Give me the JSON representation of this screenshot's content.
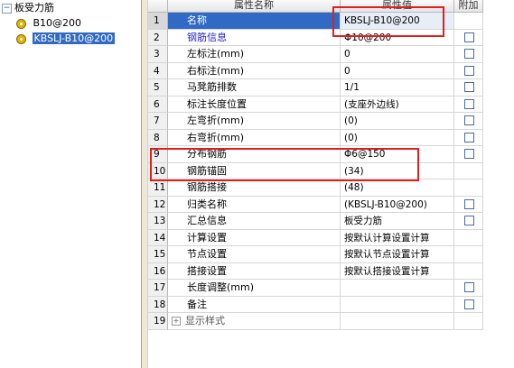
{
  "tree": {
    "root_label": "板受力筋",
    "children": [
      "B10@200",
      "KBSLJ-B10@200"
    ]
  },
  "headers": {
    "name": "属性名称",
    "value": "属性值",
    "extra": "附加"
  },
  "rows": [
    {
      "num": "1",
      "name": "名称",
      "value": "KBSLJ-B10@200",
      "checkbox": false
    },
    {
      "num": "2",
      "name": "钢筋信息",
      "value": "Φ10@200",
      "checkbox": true,
      "blue": true
    },
    {
      "num": "3",
      "name": "左标注(mm)",
      "value": "0",
      "checkbox": true
    },
    {
      "num": "4",
      "name": "右标注(mm)",
      "value": "0",
      "checkbox": true
    },
    {
      "num": "5",
      "name": "马凳筋排数",
      "value": "1/1",
      "checkbox": true
    },
    {
      "num": "6",
      "name": "标注长度位置",
      "value": "(支座外边线)",
      "checkbox": true
    },
    {
      "num": "7",
      "name": "左弯折(mm)",
      "value": "(0)",
      "checkbox": true
    },
    {
      "num": "8",
      "name": "右弯折(mm)",
      "value": "(0)",
      "checkbox": true
    },
    {
      "num": "9",
      "name": "分布钢筋",
      "value": "Φ6@150",
      "checkbox": true
    },
    {
      "num": "10",
      "name": "钢筋锚固",
      "value": "(34)",
      "checkbox": false
    },
    {
      "num": "11",
      "name": "钢筋搭接",
      "value": "(48)",
      "checkbox": false
    },
    {
      "num": "12",
      "name": "归类名称",
      "value": "(KBSLJ-B10@200)",
      "checkbox": true
    },
    {
      "num": "13",
      "name": "汇总信息",
      "value": "板受力筋",
      "checkbox": true
    },
    {
      "num": "14",
      "name": "计算设置",
      "value": "按默认计算设置计算",
      "checkbox": false
    },
    {
      "num": "15",
      "name": "节点设置",
      "value": "按默认节点设置计算",
      "checkbox": false
    },
    {
      "num": "16",
      "name": "搭接设置",
      "value": "按默认搭接设置计算",
      "checkbox": false
    },
    {
      "num": "17",
      "name": "长度调整(mm)",
      "value": "",
      "checkbox": true
    },
    {
      "num": "18",
      "name": "备注",
      "value": "",
      "checkbox": true
    },
    {
      "num": "19",
      "name": "显示样式",
      "value": "",
      "checkbox": false,
      "expander": "+"
    }
  ],
  "colors": {
    "selection": "#316ac5",
    "highlight_box": "#e02020",
    "blue_text": "#1f1fd0"
  }
}
